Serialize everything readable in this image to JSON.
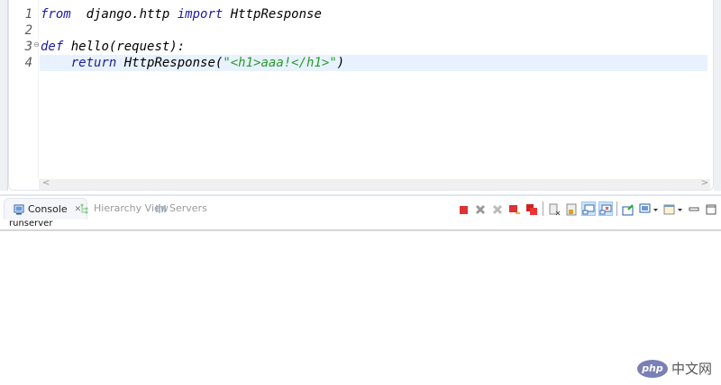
{
  "editor": {
    "lines": [
      {
        "num": "1",
        "parts": [
          [
            "kw",
            "from"
          ],
          [
            "",
            "  django.http "
          ],
          [
            "kw",
            "import"
          ],
          [
            "",
            " HttpResponse"
          ]
        ]
      },
      {
        "num": "2",
        "parts": []
      },
      {
        "num": "3",
        "parts": [
          [
            "kw",
            "def"
          ],
          [
            "",
            " hello(request):"
          ]
        ]
      },
      {
        "num": "4",
        "parts": [
          [
            "",
            "    "
          ],
          [
            "kw",
            "return"
          ],
          [
            "",
            " HttpResponse("
          ],
          [
            "str",
            "\"<h1>aaa!</h1>\""
          ],
          [
            "",
            ")"
          ]
        ]
      }
    ],
    "scroll_left": "<",
    "scroll_right": ">"
  },
  "console": {
    "tabs": [
      {
        "label": "Console",
        "close": "✕"
      },
      {
        "label": "Hierarchy View"
      },
      {
        "label": "Servers"
      }
    ],
    "process_name": "runserver"
  },
  "watermark": {
    "text": "php中文网",
    "logo": "php",
    "cn": "中文网"
  }
}
